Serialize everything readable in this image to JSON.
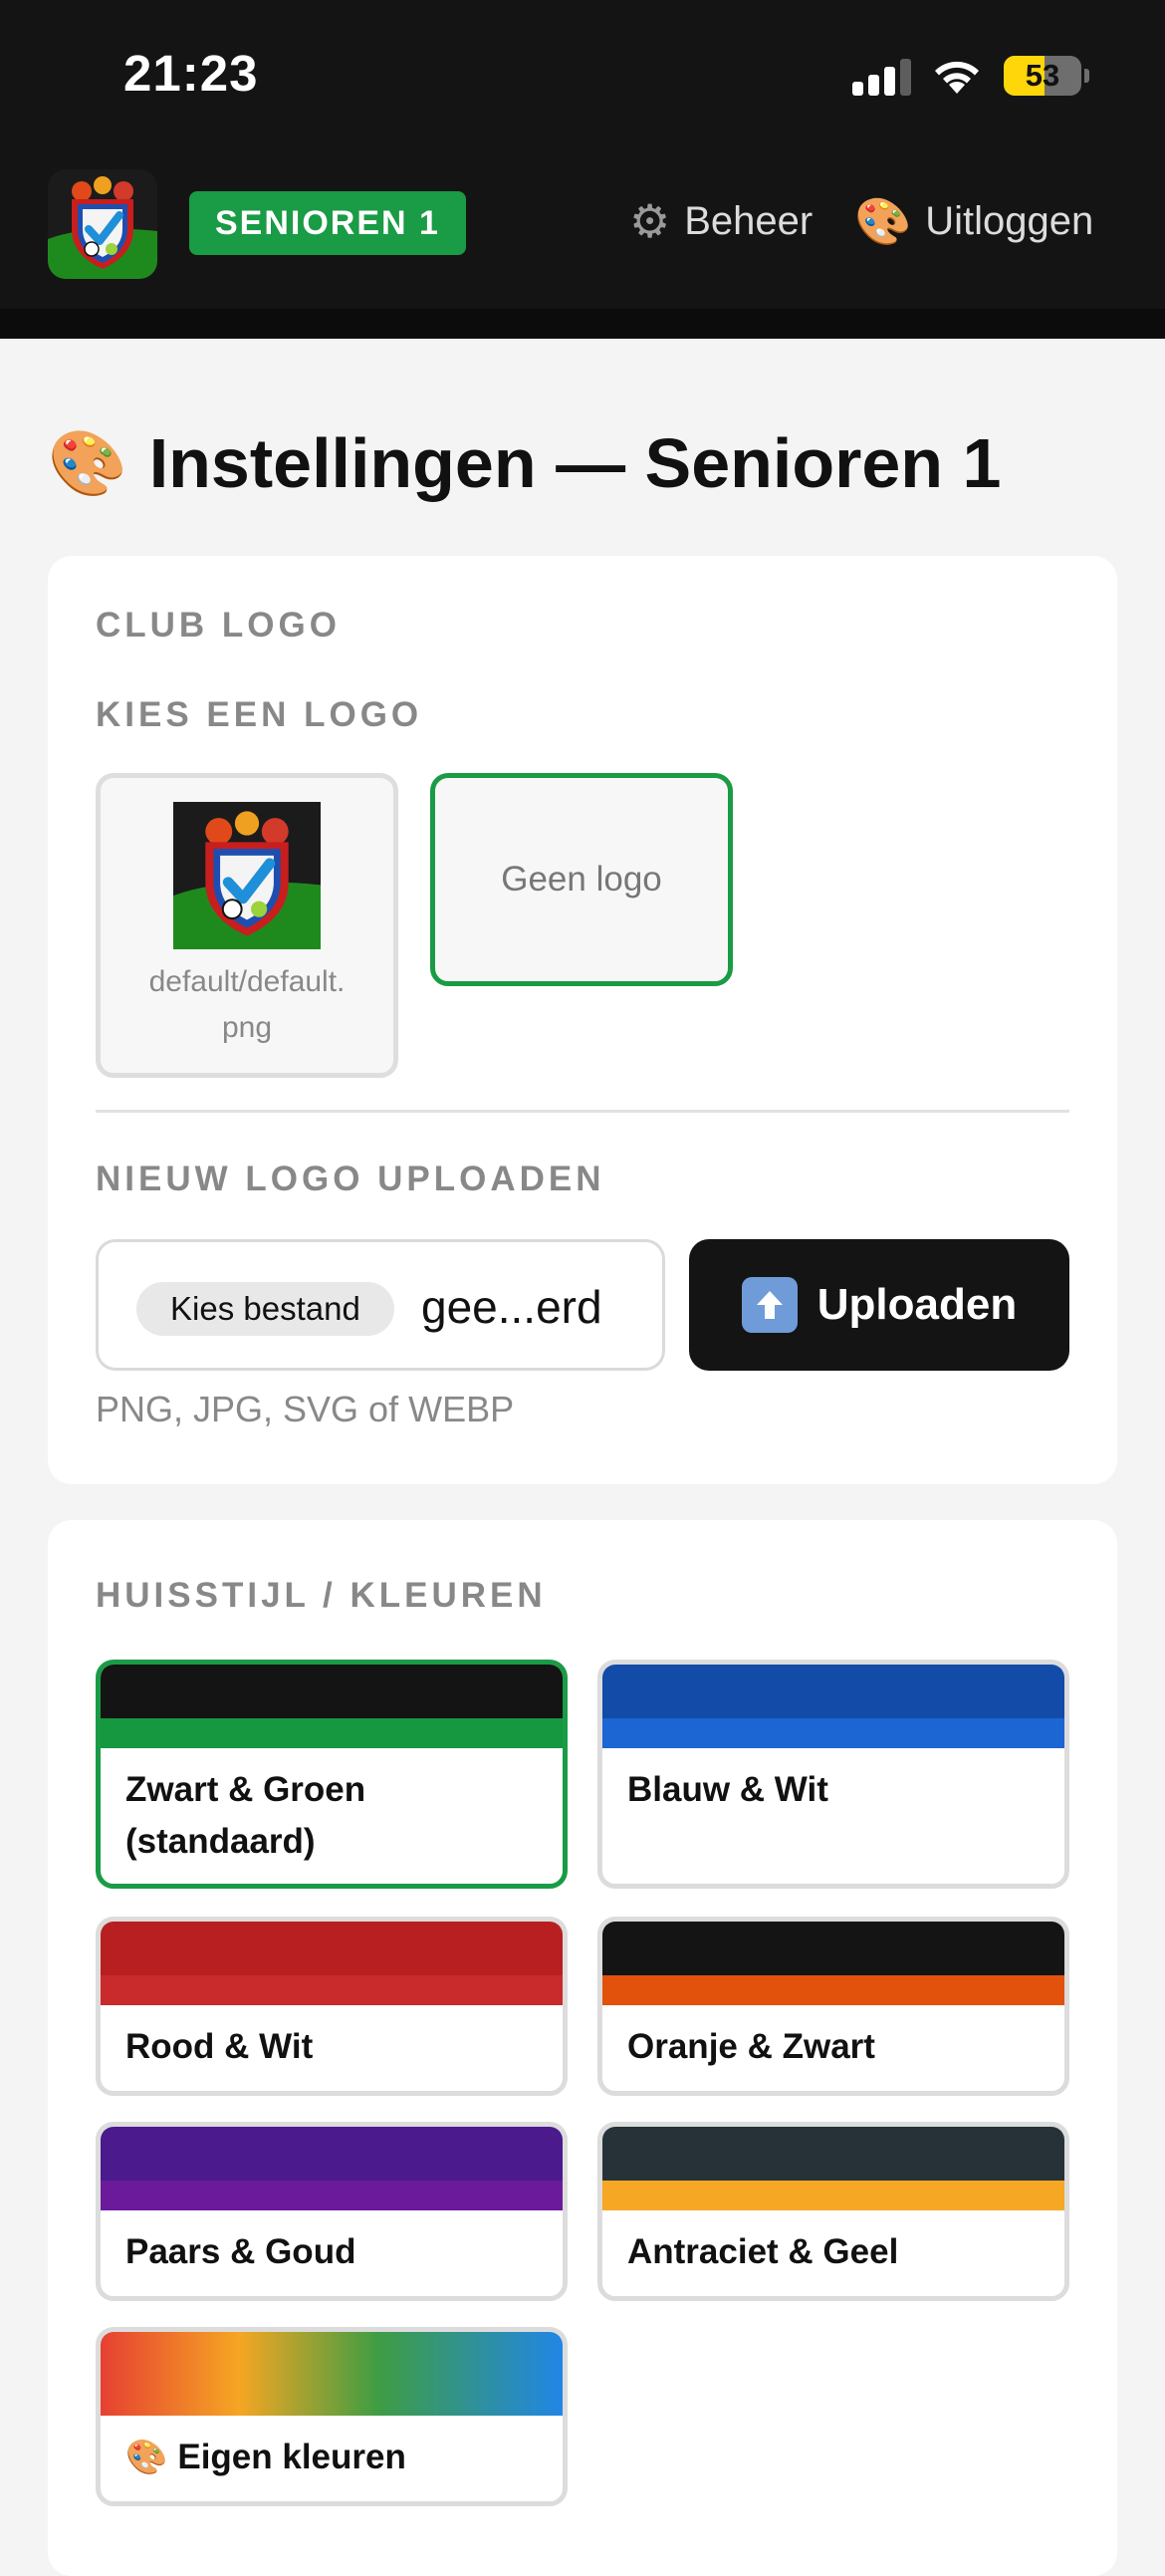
{
  "status_bar": {
    "time": "21:23",
    "battery": "53",
    "battery_level": 0.53
  },
  "header": {
    "team_badge": "SENIOREN 1",
    "nav": {
      "admin_icon": "gear-icon",
      "admin_label": "Beheer",
      "logout_icon": "palette-icon",
      "logout_label": "Uitloggen"
    }
  },
  "page": {
    "title_icon": "palette-icon",
    "title": "Instellingen — Senioren 1"
  },
  "logo_card": {
    "heading": "CLUB LOGO",
    "choose_label": "KIES EEN LOGO",
    "options": [
      {
        "caption": "default/default.\npng",
        "selected": false
      },
      {
        "caption": "Geen logo",
        "selected": true
      }
    ],
    "upload_label": "NIEUW LOGO UPLOADEN",
    "file_button": "Kies bestand",
    "file_name": "gee...erd",
    "upload_button": "Uploaden",
    "upload_icon": "up-arrow-icon",
    "hint": "PNG, JPG, SVG of WEBP"
  },
  "colors_card": {
    "heading": "HUISSTIJL / KLEUREN",
    "schemes": [
      {
        "label": "Zwart & Groen (standaard)",
        "top": "#141414",
        "bottom": "#15983f",
        "active": true
      },
      {
        "label": "Blauw & Wit",
        "top": "#134ba8",
        "bottom": "#1b66d2",
        "active": false
      },
      {
        "label": "Rood & Wit",
        "top": "#b81f21",
        "bottom": "#c92a2c",
        "active": false
      },
      {
        "label": "Oranje & Zwart",
        "top": "#141414",
        "bottom": "#e2520d",
        "active": false
      },
      {
        "label": "Paars & Goud",
        "top": "#4b1a8c",
        "bottom": "#6a1a9b",
        "active": false
      },
      {
        "label": "Antraciet & Geel",
        "top": "#263238",
        "bottom": "#f6a724",
        "active": false
      },
      {
        "label": "Eigen kleuren",
        "icon": "palette-icon",
        "rainbow": true,
        "active": false
      }
    ]
  }
}
